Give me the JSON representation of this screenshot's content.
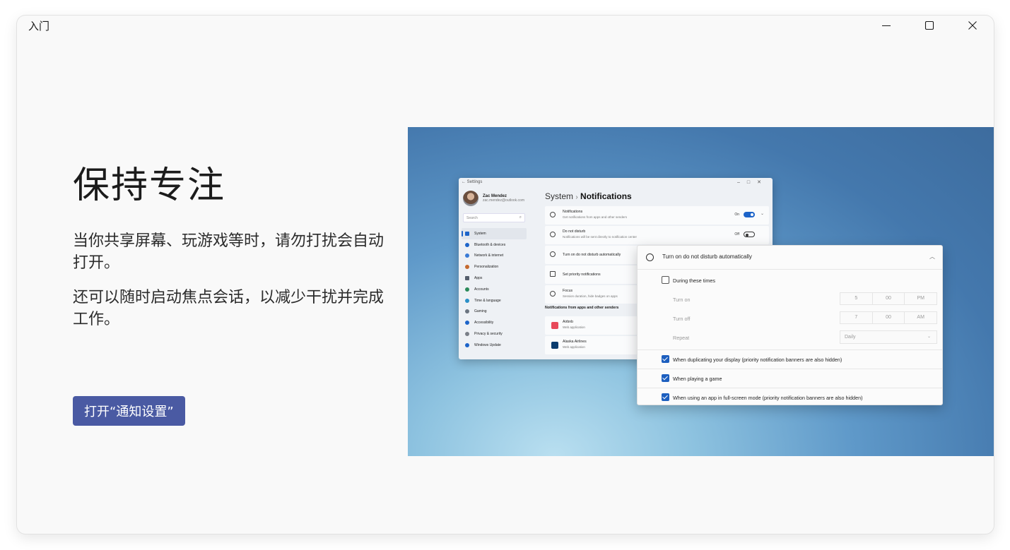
{
  "window": {
    "title": "入门"
  },
  "content": {
    "heading": "保持专注",
    "para1": "当你共享屏幕、玩游戏等时，请勿打扰会自动打开。",
    "para2": "还可以随时启动焦点会话，以减少干扰并完成工作。",
    "button": "打开“通知设置”"
  },
  "illustration": {
    "settings": {
      "window_title": "Settings",
      "user_name": "Zac Mendez",
      "user_email": "zac.mendez@outlook.com",
      "search_placeholder": "Search",
      "nav": [
        {
          "label": "System",
          "color": "#1d64c9"
        },
        {
          "label": "Bluetooth & devices",
          "color": "#1d64c9"
        },
        {
          "label": "Network & internet",
          "color": "#3a7bd5"
        },
        {
          "label": "Personalization",
          "color": "#c46a2f"
        },
        {
          "label": "Apps",
          "color": "#555e6b"
        },
        {
          "label": "Accounts",
          "color": "#2b8a5a"
        },
        {
          "label": "Time & language",
          "color": "#2a8fc7"
        },
        {
          "label": "Gaming",
          "color": "#6b7480"
        },
        {
          "label": "Accessibility",
          "color": "#1d64c9"
        },
        {
          "label": "Privacy & security",
          "color": "#7a7f88"
        },
        {
          "label": "Windows Update",
          "color": "#1d64c9"
        }
      ],
      "breadcrumb_parent": "System",
      "breadcrumb_sep": "›",
      "breadcrumb_current": "Notifications",
      "rows": {
        "notifications_title": "Notifications",
        "notifications_sub": "Get notifications from apps and other senders",
        "notifications_state": "On",
        "dnd_title": "Do not disturb",
        "dnd_sub": "Notifications will be sent directly to notification center",
        "dnd_state": "Off",
        "auto_title": "Turn on do not disturb automatically",
        "priority_title": "Set priority notifications",
        "focus_title": "Focus",
        "focus_sub": "Session duration, hide badges on apps"
      },
      "section_title": "Notifications from apps and other senders",
      "apps": [
        {
          "name": "Airbnb",
          "sub": "Web application",
          "color": "#e8495a"
        },
        {
          "name": "Alaska Airlines",
          "sub": "Web application",
          "color": "#0a3c6e"
        }
      ]
    },
    "panel": {
      "title": "Turn on do not disturb automatically",
      "during": "During these times",
      "turn_on": "Turn on",
      "turn_on_time": [
        "5",
        "00",
        "PM"
      ],
      "turn_off": "Turn off",
      "turn_off_time": [
        "7",
        "00",
        "AM"
      ],
      "repeat": "Repeat",
      "repeat_value": "Daily",
      "opt1": "When duplicating your display (priority notification banners are also hidden)",
      "opt2": "When playing a game",
      "opt3": "When using an app in full-screen mode (priority notification banners are also hidden)"
    }
  }
}
